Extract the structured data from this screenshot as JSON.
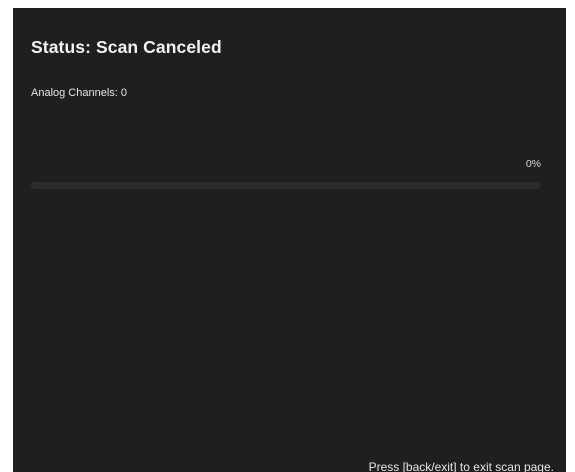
{
  "scan": {
    "status_title": "Status: Scan Canceled",
    "analog_channels_text": "Analog Channels: 0",
    "progress_text": "0%",
    "progress_value": 0
  },
  "footer": {
    "hint": "Press [back/exit] to exit scan page."
  },
  "colors": {
    "background": "#1f1f1f",
    "text": "#f2f2f2",
    "progress_track": "#2c2c2c",
    "progress_fill": "#d9d9d9"
  }
}
